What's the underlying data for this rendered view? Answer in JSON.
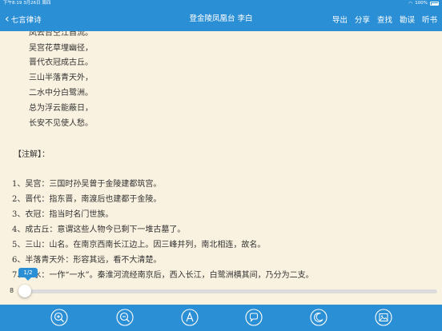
{
  "status_bar": {
    "time_date": "下午8:19   3月26日 周四",
    "battery_percent": "100%",
    "battery_level": 1.0,
    "wifi_icon": "wifi-icon"
  },
  "nav": {
    "back_label": "七言律诗",
    "title": "登金陵凤凰台  李白",
    "actions": [
      "导出",
      "分享",
      "查找",
      "勘误",
      "听书"
    ]
  },
  "poem": {
    "lines": [
      "凤去台空江自流。",
      "吴宫花草埋幽径，",
      "晋代衣冠成古丘。",
      "三山半落青天外，",
      "二水中分白鹭洲。",
      "总为浮云能蔽日，",
      "长安不见使人愁。"
    ]
  },
  "notes": {
    "heading": "【注解】：",
    "items": [
      "1、吴宫：三国时孙吴曾于金陵建都筑宫。",
      "2、晋代：指东晋，南渡后也建都于金陵。",
      "3、衣冠：指当时名门世族。",
      "4、成古丘：意谓这些人物今已剩下一堆古墓了。",
      "5、三山：山名。在南京西南长江边上。因三峰并列，南北相连，故名。",
      "6、半落青天外：形容其远，看不大清楚。",
      "7、一水：一作“一水”。秦淮河流经南京后，西入长江，白鹭洲横其间，乃分为二支。",
      "8"
    ]
  },
  "pager": {
    "page_label": "1/2",
    "position_fraction": 0.0
  },
  "toolbar": {
    "icons": [
      "zoom-in-icon",
      "zoom-out-icon",
      "font-icon",
      "bubble-icon",
      "night-mode-icon",
      "image-icon"
    ]
  },
  "colors": {
    "accent": "#2b8fd6",
    "paper": "#faf2e0",
    "text": "#333333"
  }
}
